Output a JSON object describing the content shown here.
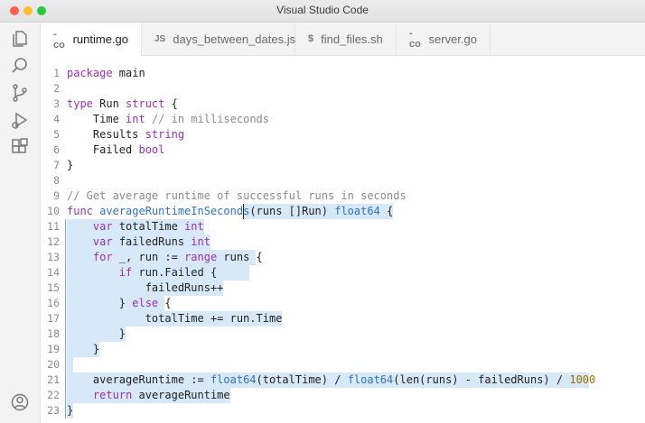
{
  "window": {
    "title": "Visual Studio Code"
  },
  "activity_bar": [
    {
      "icon": "explorer-icon"
    },
    {
      "icon": "search-icon"
    },
    {
      "icon": "source-control-icon"
    },
    {
      "icon": "run-debug-icon"
    },
    {
      "icon": "extensions-icon"
    },
    {
      "icon": "account-icon"
    }
  ],
  "tabs": [
    {
      "icon": "go-file-icon",
      "icon_text": "-co",
      "label": "runtime.go",
      "active": true
    },
    {
      "icon": "js-file-icon",
      "icon_text": "JS",
      "label": "days_between_dates.js",
      "active": false
    },
    {
      "icon": "shell-file-icon",
      "icon_text": "$",
      "label": "find_files.sh",
      "active": false
    },
    {
      "icon": "go-file-icon",
      "icon_text": "-co",
      "label": "server.go",
      "active": false
    }
  ],
  "editor": {
    "lines": [
      {
        "n": "1",
        "tokens": [
          [
            "kw",
            "package"
          ],
          [
            "pl",
            " main"
          ]
        ]
      },
      {
        "n": "2",
        "tokens": []
      },
      {
        "n": "3",
        "tokens": [
          [
            "kw",
            "type"
          ],
          [
            "pl",
            " Run "
          ],
          [
            "kw",
            "struct"
          ],
          [
            "pl",
            " {"
          ]
        ]
      },
      {
        "n": "4",
        "tokens": [
          [
            "pl",
            "    Time "
          ],
          [
            "ty",
            "int"
          ],
          [
            "cm",
            " // in milliseconds"
          ]
        ]
      },
      {
        "n": "5",
        "tokens": [
          [
            "pl",
            "    Results "
          ],
          [
            "ty",
            "string"
          ]
        ]
      },
      {
        "n": "6",
        "tokens": [
          [
            "pl",
            "    Failed "
          ],
          [
            "ty",
            "bool"
          ]
        ]
      },
      {
        "n": "7",
        "tokens": [
          [
            "pl",
            "}"
          ]
        ]
      },
      {
        "n": "8",
        "tokens": []
      },
      {
        "n": "9",
        "tokens": [
          [
            "cm",
            "// Get average runtime of successful runs in seconds"
          ]
        ]
      },
      {
        "n": "10",
        "tokens": [
          [
            "kw",
            "func"
          ],
          [
            "pl",
            " "
          ],
          [
            "fn",
            "averageRuntimeInSeconds"
          ],
          [
            "pl",
            "(runs []Run) "
          ],
          [
            "fn",
            "float64"
          ],
          [
            "pl",
            " {"
          ]
        ]
      },
      {
        "n": "11",
        "tokens": [
          [
            "pl",
            "    "
          ],
          [
            "kw",
            "var"
          ],
          [
            "pl",
            " totalTime "
          ],
          [
            "ty",
            "int"
          ]
        ]
      },
      {
        "n": "12",
        "tokens": [
          [
            "pl",
            "    "
          ],
          [
            "kw",
            "var"
          ],
          [
            "pl",
            " failedRuns "
          ],
          [
            "ty",
            "int"
          ]
        ]
      },
      {
        "n": "13",
        "tokens": [
          [
            "pl",
            "    "
          ],
          [
            "kw",
            "for"
          ],
          [
            "pl",
            " _, run := "
          ],
          [
            "kw",
            "range"
          ],
          [
            "pl",
            " runs {"
          ]
        ]
      },
      {
        "n": "14",
        "tokens": [
          [
            "pl",
            "        "
          ],
          [
            "kw",
            "if"
          ],
          [
            "pl",
            " run.Failed {"
          ]
        ]
      },
      {
        "n": "15",
        "tokens": [
          [
            "pl",
            "            failedRuns++"
          ]
        ]
      },
      {
        "n": "16",
        "tokens": [
          [
            "pl",
            "        } "
          ],
          [
            "kw",
            "else"
          ],
          [
            "pl",
            " {"
          ]
        ]
      },
      {
        "n": "17",
        "tokens": [
          [
            "pl",
            "            totalTime += run.Time"
          ]
        ]
      },
      {
        "n": "18",
        "tokens": [
          [
            "pl",
            "        }"
          ]
        ]
      },
      {
        "n": "19",
        "tokens": [
          [
            "pl",
            "    }"
          ]
        ]
      },
      {
        "n": "20",
        "tokens": []
      },
      {
        "n": "21",
        "tokens": [
          [
            "pl",
            "    averageRuntime := "
          ],
          [
            "fn",
            "float64"
          ],
          [
            "pl",
            "(totalTime) / "
          ],
          [
            "fn",
            "float64"
          ],
          [
            "pl",
            "(len(runs) - failedRuns) / "
          ],
          [
            "nm",
            "1000"
          ]
        ]
      },
      {
        "n": "22",
        "tokens": [
          [
            "pl",
            "    "
          ],
          [
            "kw",
            "return"
          ],
          [
            "pl",
            " averageRuntime"
          ]
        ]
      },
      {
        "n": "23",
        "tokens": [
          [
            "pl",
            "}"
          ]
        ]
      }
    ]
  },
  "colors": {
    "keyword": "#9b2fb0",
    "function": "#2f74c0",
    "comment": "#8a8a8a",
    "number": "#9a7000",
    "selection": "#d7e8f8"
  }
}
